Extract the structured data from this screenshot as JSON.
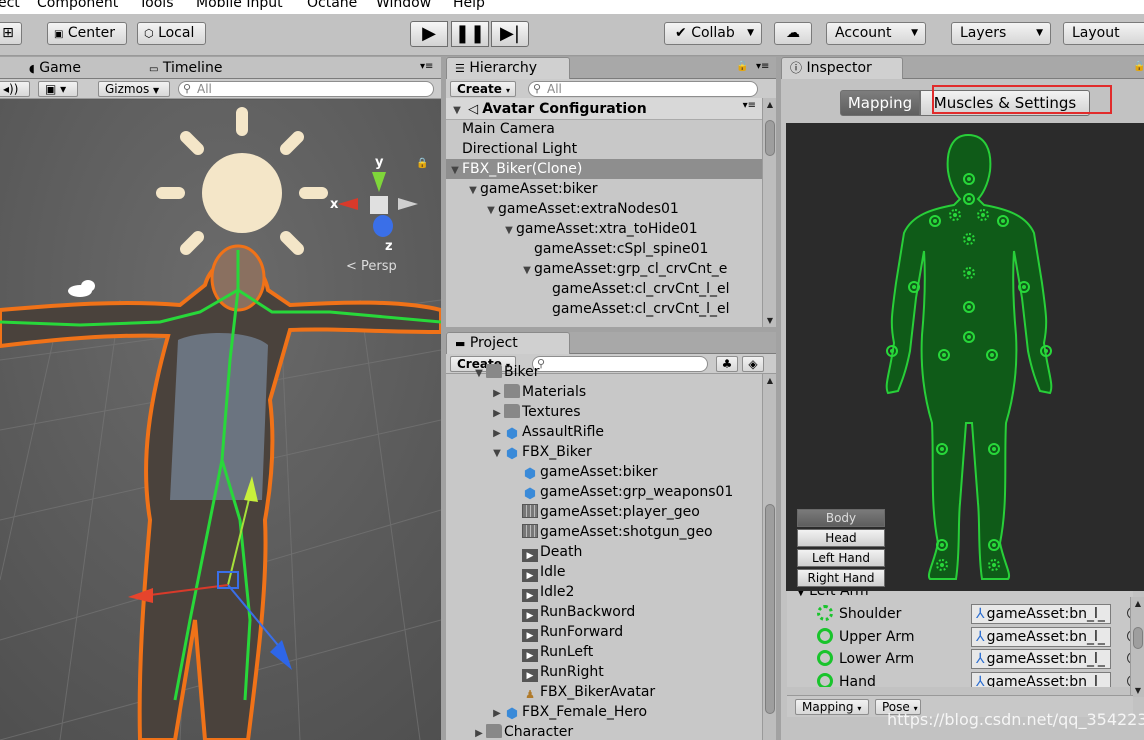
{
  "menu": [
    "ect",
    "Component",
    "Tools",
    "Mobile Input",
    "Octane",
    "Window",
    "Help"
  ],
  "toolbar": {
    "center_label": "Center",
    "local_label": "Local",
    "collab_label": "Collab",
    "account_label": "Account",
    "layers_label": "Layers",
    "layout_label": "Layout"
  },
  "scene": {
    "tabs": [
      "Game",
      "Timeline"
    ],
    "gizmos_label": "Gizmos",
    "search_placeholder": "All",
    "persp_label": "Persp",
    "axis": {
      "x": "x",
      "y": "y",
      "z": "z"
    }
  },
  "hierarchy": {
    "tab": "Hierarchy",
    "create_label": "Create",
    "search_placeholder": "All",
    "scene_name": "Avatar Configuration",
    "rows": [
      {
        "label": "Main Camera",
        "depth": 1,
        "arrow": ""
      },
      {
        "label": "Directional Light",
        "depth": 1,
        "arrow": ""
      },
      {
        "label": "FBX_Biker(Clone)",
        "depth": 1,
        "arrow": "▼",
        "selected": true
      },
      {
        "label": "gameAsset:biker",
        "depth": 2,
        "arrow": "▼"
      },
      {
        "label": "gameAsset:extraNodes01",
        "depth": 3,
        "arrow": "▼"
      },
      {
        "label": "gameAsset:xtra_toHide01",
        "depth": 4,
        "arrow": "▼"
      },
      {
        "label": "gameAsset:cSpl_spine01",
        "depth": 5,
        "arrow": ""
      },
      {
        "label": "gameAsset:grp_cl_crvCnt_e",
        "depth": 5,
        "arrow": "▼"
      },
      {
        "label": "gameAsset:cl_crvCnt_l_el",
        "depth": 6,
        "arrow": ""
      },
      {
        "label": "gameAsset:cl_crvCnt_l_el",
        "depth": 6,
        "arrow": ""
      }
    ]
  },
  "project": {
    "tab": "Project",
    "create_label": "Create",
    "rows": [
      {
        "label": "Biker",
        "depth": 1,
        "arrow": "▼",
        "icon": "folder"
      },
      {
        "label": "Materials",
        "depth": 2,
        "arrow": "▶",
        "icon": "folder"
      },
      {
        "label": "Textures",
        "depth": 2,
        "arrow": "▶",
        "icon": "folder"
      },
      {
        "label": "AssaultRifle",
        "depth": 2,
        "arrow": "▶",
        "icon": "cube"
      },
      {
        "label": "FBX_Biker",
        "depth": 2,
        "arrow": "▼",
        "icon": "cube"
      },
      {
        "label": "gameAsset:biker",
        "depth": 3,
        "arrow": "",
        "icon": "cube"
      },
      {
        "label": "gameAsset:grp_weapons01",
        "depth": 3,
        "arrow": "",
        "icon": "cube"
      },
      {
        "label": "gameAsset:player_geo",
        "depth": 3,
        "arrow": "",
        "icon": "mesh"
      },
      {
        "label": "gameAsset:shotgun_geo",
        "depth": 3,
        "arrow": "",
        "icon": "mesh"
      },
      {
        "label": "Death",
        "depth": 3,
        "arrow": "",
        "icon": "anim"
      },
      {
        "label": "Idle",
        "depth": 3,
        "arrow": "",
        "icon": "anim"
      },
      {
        "label": "Idle2",
        "depth": 3,
        "arrow": "",
        "icon": "anim"
      },
      {
        "label": "RunBackword",
        "depth": 3,
        "arrow": "",
        "icon": "anim"
      },
      {
        "label": "RunForward",
        "depth": 3,
        "arrow": "",
        "icon": "anim"
      },
      {
        "label": "RunLeft",
        "depth": 3,
        "arrow": "",
        "icon": "anim"
      },
      {
        "label": "RunRight",
        "depth": 3,
        "arrow": "",
        "icon": "anim"
      },
      {
        "label": "FBX_BikerAvatar",
        "depth": 3,
        "arrow": "",
        "icon": "avatar"
      },
      {
        "label": "FBX_Female_Hero",
        "depth": 2,
        "arrow": "▶",
        "icon": "cube"
      },
      {
        "label": "Character",
        "depth": 1,
        "arrow": "▶",
        "icon": "folder"
      }
    ]
  },
  "inspector": {
    "tab": "Inspector",
    "mapping_tab": "Mapping",
    "muscles_tab": "Muscles & Settings",
    "view_buttons": [
      "Body",
      "Head",
      "Left Hand",
      "Right Hand"
    ],
    "section_label": "Left Arm",
    "bones": [
      {
        "label": "Shoulder",
        "value": "gameAsset:bn_l_",
        "style": "dashed"
      },
      {
        "label": "Upper Arm",
        "value": "gameAsset:bn_l_",
        "style": "solid"
      },
      {
        "label": "Lower Arm",
        "value": "gameAsset:bn_l_",
        "style": "solid"
      },
      {
        "label": "Hand",
        "value": "gameAsset:bn_l_",
        "style": "solid"
      }
    ],
    "bottom_menu": {
      "mapping": "Mapping",
      "pose": "Pose"
    }
  },
  "watermark": "https://blog.csdn.net/qq_35422344",
  "colors": {
    "accent_green": "#28d83a",
    "highlight_red": "#e12b2b",
    "selection": "#8e8e8e"
  }
}
